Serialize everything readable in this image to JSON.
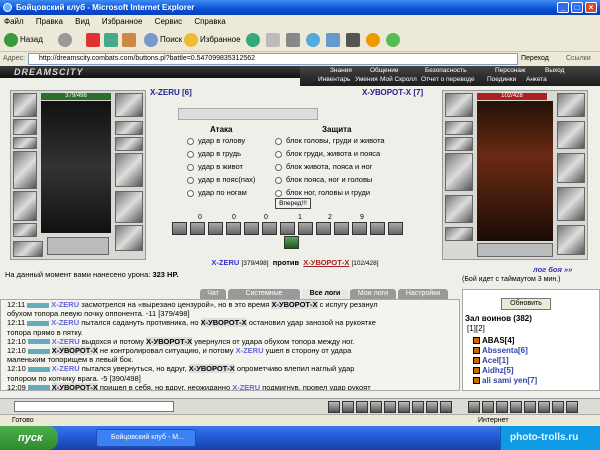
{
  "window": {
    "title": "Бойцовский клуб - Microsoft Internet Explorer"
  },
  "menu": [
    "Файл",
    "Правка",
    "Вид",
    "Избранное",
    "Сервис",
    "Справка"
  ],
  "toolbar": {
    "back": "Назад",
    "search": "Поиск",
    "favorites": "Избранное"
  },
  "address": {
    "label": "Адрес:",
    "url": "http://dreamscity.combats.com/buttons.pl?battle=0.547099835312562",
    "go": "Переход",
    "links": "Ссылки"
  },
  "site": {
    "logo": "DREAMSCITY"
  },
  "topnav": {
    "row1": [
      "Знания",
      "Общение",
      "Безопасность",
      "Персонаж",
      "Выход"
    ],
    "row2": [
      "Инвентарь",
      "Умения",
      "Мой Скролл",
      "Отчет о переводе",
      "Поединки",
      "Анкета"
    ]
  },
  "left_fighter": {
    "name": "X-ZERU [6]",
    "hp": "379/498"
  },
  "right_fighter": {
    "name": "Х-УВОРОТ-Х [7]",
    "hp": "102/428"
  },
  "attack": {
    "title": "Атака",
    "options": [
      "удар в голову",
      "удар в грудь",
      "удар в живот",
      "удар в пояс(пах)",
      "удар по ногам"
    ]
  },
  "defense": {
    "title": "Защита",
    "options": [
      "блок головы, груди и живота",
      "блок груди, живота и пояса",
      "блок живота, пояса и ног",
      "блок пояса, ног и головы",
      "блок ног, головы и груди"
    ]
  },
  "strike_button": "Вперед!!!",
  "counters": [
    "0",
    "0",
    "0",
    "1",
    "2",
    "9"
  ],
  "vs": {
    "left": "X-ZERU",
    "left_hp": "[379/498]",
    "word": "против",
    "right": "Х-УВОРОТ-Х",
    "right_hp": "[102/428]"
  },
  "damage": {
    "text": "На данный момент вами нанесено урона:",
    "value": "323 HP."
  },
  "fight_log_link": "лог боя »»",
  "timeout": "(Бой идет с таймаутом 3 мин.)",
  "tabs": [
    "Чат",
    "Системные сообщения",
    "Все логи",
    "Мои логи",
    "Настройки"
  ],
  "chat": [
    {
      "time": "12:11",
      "a": "X-ZERU",
      "text": " засмотрелся на «вырезано цензурой», но в это время ",
      "b": "Х-УВОРОТ-Х",
      "rest": " с испугу резанул"
    },
    {
      "time": "",
      "a": "",
      "text": "обухом топора левую почку оппонента. -11 [379/498]",
      "b": "",
      "rest": ""
    },
    {
      "time": "12:11",
      "a": "X-ZERU",
      "text": " пытался садануть противника, но ",
      "b": "Х-УВОРОТ-Х",
      "rest": " остановил удар занозой на рукоятке"
    },
    {
      "time": "",
      "a": "",
      "text": "топора прямо в пятку.",
      "b": "",
      "rest": ""
    },
    {
      "time": "12:10",
      "a": "X-ZERU",
      "text": " выдохся и потому ",
      "b": "Х-УВОРОТ-Х",
      "rest": " увернулся от удара обухом топора между ног."
    },
    {
      "time": "12:10",
      "a": "Х-УВОРОТ-Х",
      "text": " не контролировал ситуацию, и потому ",
      "b": "X-ZERU",
      "rest": " ушел в сторону от удара"
    },
    {
      "time": "",
      "a": "",
      "text": "маленьким топорищем в левый бок.",
      "b": "",
      "rest": ""
    },
    {
      "time": "12:10",
      "a": "X-ZERU",
      "text": " пытался увернуться, но вдруг, ",
      "b": "Х-УВОРОТ-Х",
      "rest": " опрометчиво влепил наглый удар"
    },
    {
      "time": "",
      "a": "",
      "text": "топором по копчику врага. -5 [390/498]",
      "b": "",
      "rest": ""
    },
    {
      "time": "12:09",
      "a": "Х-УВОРОТ-Х",
      "text": " пришел в себя, но вдруг, неожиданно ",
      "b": "X-ZERU",
      "rest": " подмигнув, провел удар рукоят"
    }
  ],
  "room": {
    "refresh": "Обновить",
    "title": "Зал воинов (382)",
    "page": "[1][2]",
    "users": [
      "ABAS[4]",
      "Abssenta[6]",
      "Acel[1]",
      "Aidhz[5]",
      "ali sami yen[7]"
    ]
  },
  "status": {
    "left": "Готово",
    "right": "Интернет"
  },
  "taskbar": {
    "start": "пуск",
    "task": "Бойцовский клуб - M..."
  },
  "watermark": "photo-trolls.ru"
}
